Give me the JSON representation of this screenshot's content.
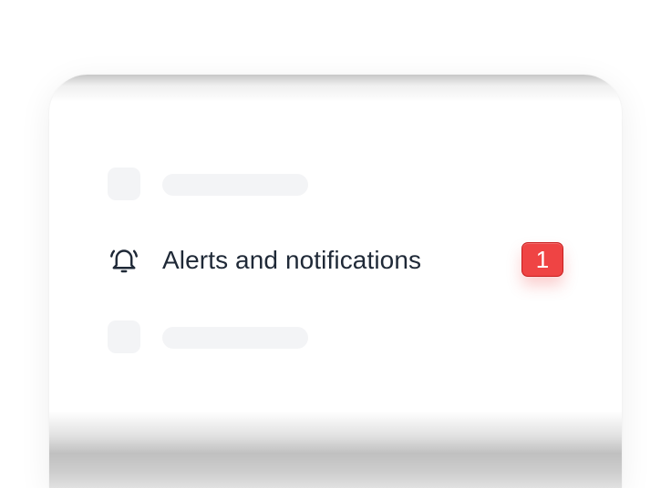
{
  "list": {
    "placeholders": [
      "",
      ""
    ],
    "alert_item": {
      "icon": "bell-icon",
      "label": "Alerts and notifications",
      "badge_count": "1"
    }
  },
  "colors": {
    "badge": "#ef4444",
    "text": "#1f2937",
    "placeholder": "#f3f4f6"
  }
}
